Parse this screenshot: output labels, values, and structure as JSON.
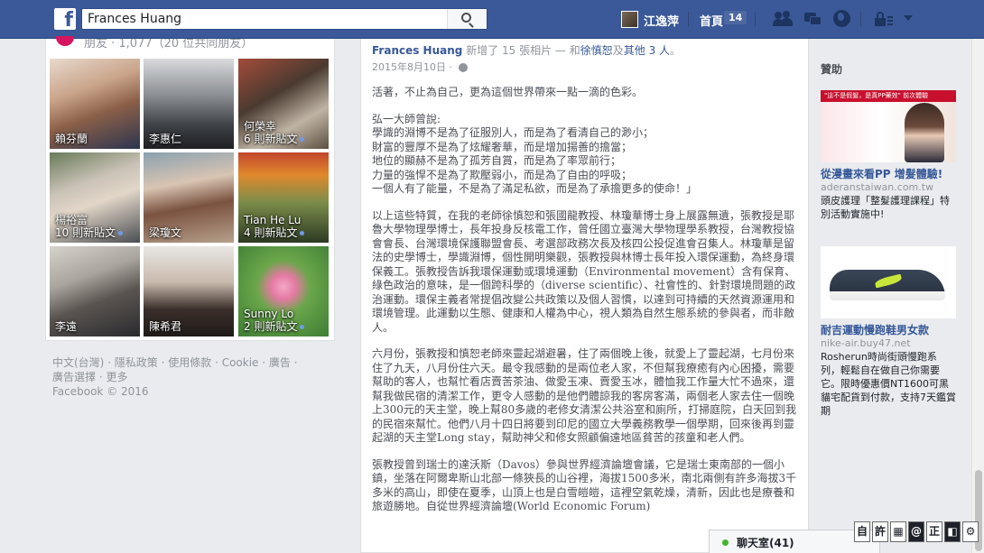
{
  "topbar": {
    "logo": "f",
    "search_value": "Frances Huang",
    "user_name": "江逸萍",
    "home_label": "首頁",
    "home_count": "14"
  },
  "friends": {
    "header": "朋友 · 1,077（20 位共同朋友）",
    "tiles": [
      {
        "name": "賴芬蘭",
        "note": ""
      },
      {
        "name": "李惠仁",
        "note": ""
      },
      {
        "name": "何榮幸",
        "note": "6 則新貼文"
      },
      {
        "name": "楊裕富",
        "note": "10 則新貼文"
      },
      {
        "name": "梁瓊文",
        "note": ""
      },
      {
        "name": "Tian He Lu",
        "note": "4 則新貼文"
      },
      {
        "name": "李遠",
        "note": ""
      },
      {
        "name": "陳希君",
        "note": ""
      },
      {
        "name": "Sunny Lo",
        "note": "2 則新貼文"
      }
    ]
  },
  "footer": {
    "line1": "中文(台灣) · 隱私政策 · 使用條款 · Cookie · 廣告 ·",
    "line2": "廣告選擇 · 更多",
    "line3": "Facebook © 2016"
  },
  "post": {
    "author": "Frances Huang",
    "action": " 新增了 15 張相片 — 和",
    "tagged": "徐慎恕",
    "and": "及",
    "others": "其他 3 人",
    "period": "。",
    "date": "2015年8月10日 · ",
    "p1": "活著，不止為自己，更為這個世界帶來一點一滴的色彩。",
    "p2": "弘一大師曾說:\n學識的淵博不是為了征服別人，而是為了看清自己的渺小；\n財富的豐厚不是為了炫耀奢華，而是增加揚善的擔當；\n地位的顯赫不是為了孤芳自賞，而是為了率眾前行；\n力量的強悍不是為了欺壓弱小，而是為了自由的呼吸；\n一個人有了能量，不是為了滿足私欲，而是為了承擔更多的使命！」",
    "p3": "以上這些特質，在我的老師徐慎恕和張國龍教授、林瓊華博士身上展露無遺，張教授是耶魯大學物理學博士，長年投身反核電工作，曾任國立臺灣大學物理學系教授，台灣教授協會會長、台灣環境保護聯盟會長、考選部政務次長及核四公投促進會召集人。林瓊華是留法的史學博士，學識淵博，個性開明樂觀，張教授與林博士長年投入環保運動，為終身環保義工。張教授告訴我環保運動或環境運動（Environmental movement）含有保育、綠色政治的意味，是一個跨科學的（diverse scientific）、社會性的、針對環境問題的政治運動。環保主義者常提倡改變公共政策以及個人習慣，以達到可持續的天然資源運用和環境管理。此運動以生態、健康和人權為中心，視人類為自然生態系統的參與者，而非敵人。",
    "p4": "六月份，張教授和慎恕老師來靈起湖避暑，住了兩個晚上後，就愛上了靈起湖，七月份來住了九天，八月份住六天。最令我感動的是兩位老人家，不但幫我療癒有內心困擾，需要幫助的客人，也幫忙看店賣苦茶油、做愛玉凍、賣愛玉冰，體恤我工作量大忙不過來，還幫我做民宿的清潔工作，更令人感動的是他們體諒我的客房客滿，兩個老人家去住一個晚上300元的天主堂，晚上幫80多歲的老修女清潔公共浴室和廁所，打掃庭院，白天回到我的民宿來幫忙。他們八月十四日將要到印尼的國立大學義務教學一個學期，回來後再到靈起湖的天主堂Long stay，幫助神父和修女照顧偏遠地區貧苦的孩童和老人們。",
    "p5": "張教授曾到瑞士的達沃斯（Davos）參與世界經濟論壇會議，它是瑞士東南部的一個小鎮，坐落在阿爾卑斯山北部一條狹長的山谷裡，海拔1500多米，南北兩側有許多海拔3千多米的高山，即使在夏季，山頂上也是白雪皚皚，這裡空氣乾燥，清新，因此也是療養和旅遊勝地。自從世界經濟論壇(World Economic Forum)"
  },
  "right": {
    "sponsored": "贊助",
    "ad1": {
      "banner": "\"這不是假髮，是真PP藥效\" 前次體驗",
      "title": "從漫畫來看PP 增髮體驗!",
      "domain": "aderanstaiwan.com.tw",
      "body": "頭皮護理「整髮護理課程」特別活動實施中!"
    },
    "ad2": {
      "title": "耐吉運動慢跑鞋男女款",
      "domain": "nike-air.buy47.net",
      "body": "Rosherun時尚街頭慢跑系列，輕鬆自在做自己你需要它。限時優惠價NT1600可黑貓宅配貨到付款，支持7天鑑賞期"
    }
  },
  "chat": {
    "label": "聊天室(41)"
  },
  "ime": [
    "自",
    "許",
    "▦",
    "@",
    "正",
    "◧",
    "⚙"
  ],
  "colors": {
    "brand_blue": "#3b5998",
    "link_blue": "#365899",
    "online_green": "#42b72a"
  }
}
